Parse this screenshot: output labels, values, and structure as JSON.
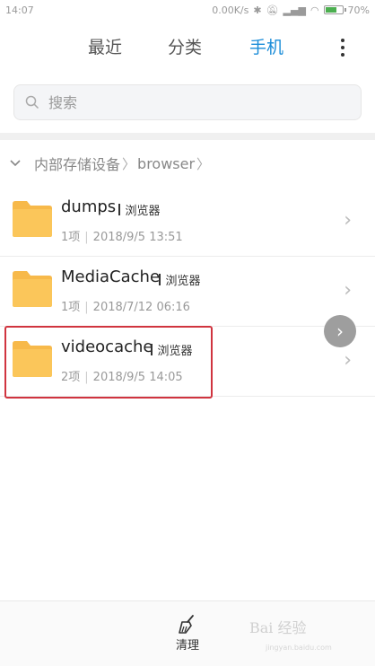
{
  "status": {
    "time": "14:07",
    "net_speed": "0.00K/s",
    "battery": "70%",
    "battery_level": 0.7
  },
  "tabs": [
    {
      "label": "最近",
      "active": false
    },
    {
      "label": "分类",
      "active": false
    },
    {
      "label": "手机",
      "active": true
    }
  ],
  "search": {
    "placeholder": "搜索"
  },
  "breadcrumb": [
    "内部存储设备",
    "browser"
  ],
  "files": [
    {
      "name": "dumps",
      "owner": "浏览器",
      "count": "1项",
      "modified": "2018/9/5 13:51"
    },
    {
      "name": "MediaCache",
      "owner": "浏览器",
      "count": "1项",
      "modified": "2018/7/12 06:16"
    },
    {
      "name": "videocache",
      "owner": "浏览器",
      "count": "2项",
      "modified": "2018/9/5 14:05",
      "highlighted": true
    }
  ],
  "bottom": {
    "clean_label": "清理"
  },
  "watermark": {
    "text": "Bai 经验",
    "sub": "jingyan.baidu.com"
  },
  "colors": {
    "accent": "#1a8cd8",
    "folder": "#f7b94a",
    "highlight_border": "#d0343f"
  }
}
